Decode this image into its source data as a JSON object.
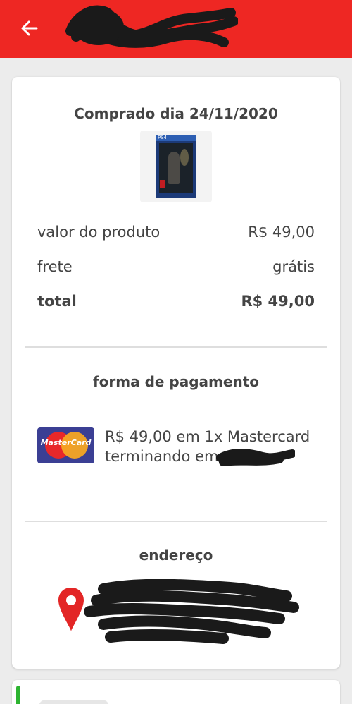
{
  "header": {
    "back_icon": "arrow-left-icon",
    "title_redacted": true,
    "color": "#ee2723"
  },
  "order": {
    "purchase_date": "Comprado dia 24/11/2020",
    "product_image": "product-cover-ps4",
    "product_cover_label": "PS4",
    "rows": [
      {
        "label": "valor do produto",
        "value": "R$ 49,00"
      },
      {
        "label": "frete",
        "value": "grátis"
      },
      {
        "label": "total",
        "value": "R$ 49,00"
      }
    ]
  },
  "payment": {
    "heading": "forma de pagamento",
    "card_logo_text": "MasterCard",
    "line1": "R$ 49,00 em 1x Mastercard",
    "line2": "terminando em"
  },
  "address": {
    "heading": "endereço",
    "pin_icon": "location-pin-icon",
    "pin_color": "#e32626"
  },
  "next_card": {
    "accent_color": "#2db431"
  }
}
